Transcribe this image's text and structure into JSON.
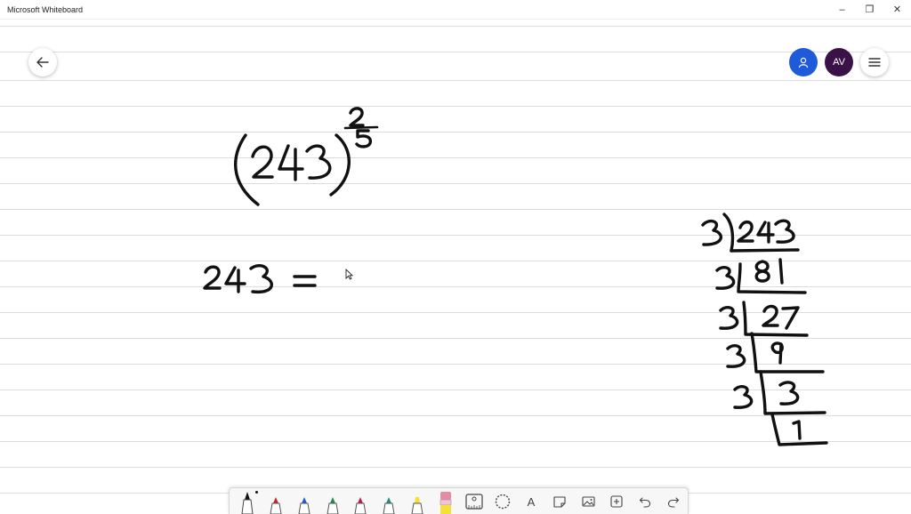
{
  "window": {
    "title": "Microsoft Whiteboard",
    "controls": {
      "minimize": "–",
      "maximize": "❐",
      "close": "✕"
    }
  },
  "header": {
    "back_icon": "arrow-left-icon",
    "share_icon": "person-icon",
    "avatar_initials": "AV",
    "menu_icon": "hamburger-icon"
  },
  "colors": {
    "share": "#1f5bd8",
    "avatar": "#3a1247",
    "ink": "#111111",
    "pen_black": "#111111",
    "pen_red": "#c4262b",
    "pen_blue": "#1f5bd8",
    "pen_green": "#1f8a4d",
    "pen_magenta": "#c2185b",
    "pen_teal": "#1f8c8c",
    "highlighter": "#f3e13a",
    "eraser_pink": "#e58ba6"
  },
  "toolbar": {
    "tools": [
      {
        "id": "pen-black",
        "icon": "pen-icon",
        "selected": true
      },
      {
        "id": "pen-red",
        "icon": "pen-icon"
      },
      {
        "id": "pen-blue",
        "icon": "pen-icon"
      },
      {
        "id": "pen-green",
        "icon": "pen-icon"
      },
      {
        "id": "pen-magenta",
        "icon": "pen-icon"
      },
      {
        "id": "pen-teal",
        "icon": "pen-icon"
      },
      {
        "id": "highlighter",
        "icon": "highlighter-icon"
      },
      {
        "id": "eraser",
        "icon": "eraser-icon"
      },
      {
        "id": "ruler",
        "icon": "ruler-icon"
      },
      {
        "id": "lasso",
        "icon": "lasso-icon"
      },
      {
        "id": "text",
        "icon": "text-icon",
        "glyph": "A"
      },
      {
        "id": "note",
        "icon": "sticky-note-icon"
      },
      {
        "id": "image",
        "icon": "image-icon"
      },
      {
        "id": "insert",
        "icon": "add-icon"
      },
      {
        "id": "undo",
        "icon": "undo-icon"
      },
      {
        "id": "redo",
        "icon": "redo-icon"
      }
    ]
  }
}
